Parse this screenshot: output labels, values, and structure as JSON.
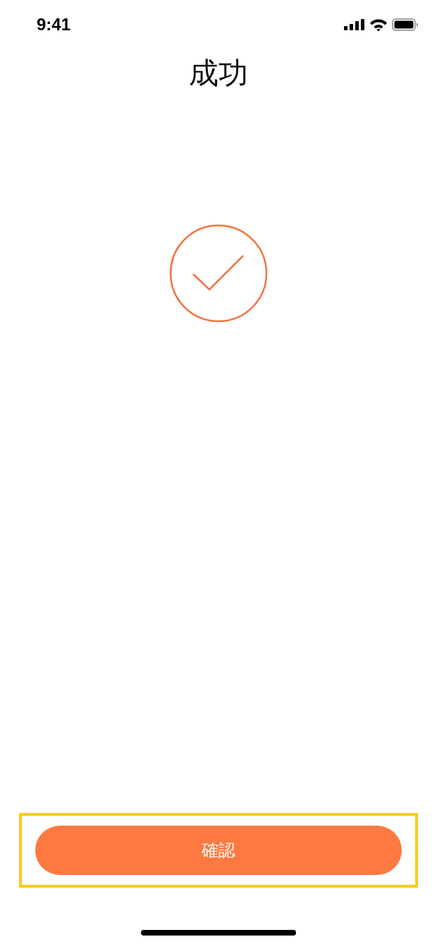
{
  "status_bar": {
    "time": "9:41"
  },
  "title": "成功",
  "confirm_button": {
    "label": "確認",
    "highlighted": true
  }
}
